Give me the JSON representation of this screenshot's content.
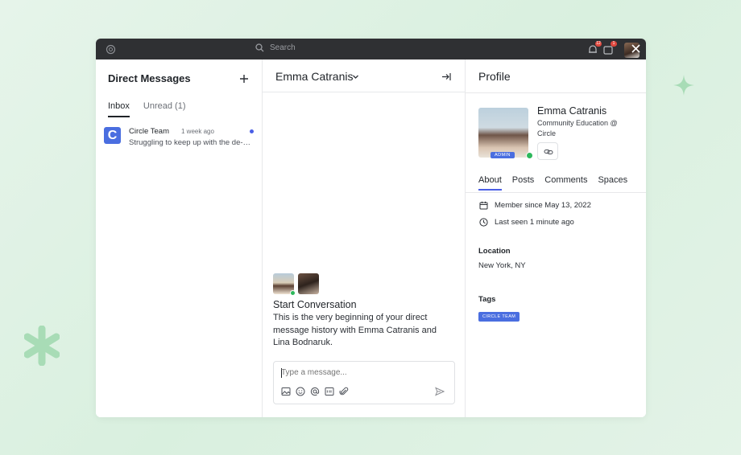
{
  "colors": {
    "accent": "#4a6ee0",
    "online": "#2eb85c",
    "topbar": "#2f3033",
    "badge": "#e0483e",
    "decoration": "#a8dcb6"
  },
  "topbar": {
    "search_placeholder": "Search",
    "notifications_badge": "12",
    "messages_badge": "1"
  },
  "direct_messages": {
    "title": "Direct Messages",
    "tabs": [
      {
        "label": "Inbox",
        "active": true
      },
      {
        "label": "Unread (1)",
        "active": false
      }
    ],
    "conversations": [
      {
        "logo_letter": "C",
        "name": "Circle Team",
        "time": "1 week ago",
        "preview": "Struggling to keep up with the de-…",
        "unread": true
      }
    ]
  },
  "chat": {
    "header_name": "Emma Catranis",
    "start_title": "Start Conversation",
    "start_description": "This is the very beginning of your direct message history with Emma Catranis and Lina Bodnaruk.",
    "composer_placeholder": "Type a message...",
    "tools": [
      "image-icon",
      "emoji-icon",
      "mention-icon",
      "gif-icon",
      "attachment-icon"
    ]
  },
  "profile": {
    "title": "Profile",
    "name": "Emma Catranis",
    "role": "Community Education @ Circle",
    "badge": "ADMIN",
    "tabs": [
      {
        "label": "About",
        "active": true
      },
      {
        "label": "Posts",
        "active": false
      },
      {
        "label": "Comments",
        "active": false
      },
      {
        "label": "Spaces",
        "active": false
      }
    ],
    "member_since": "Member since May 13, 2022",
    "last_seen": "Last seen 1 minute ago",
    "location_label": "Location",
    "location_value": "New York, NY",
    "tags_label": "Tags",
    "tags": [
      "CIRCLE TEAM"
    ]
  }
}
